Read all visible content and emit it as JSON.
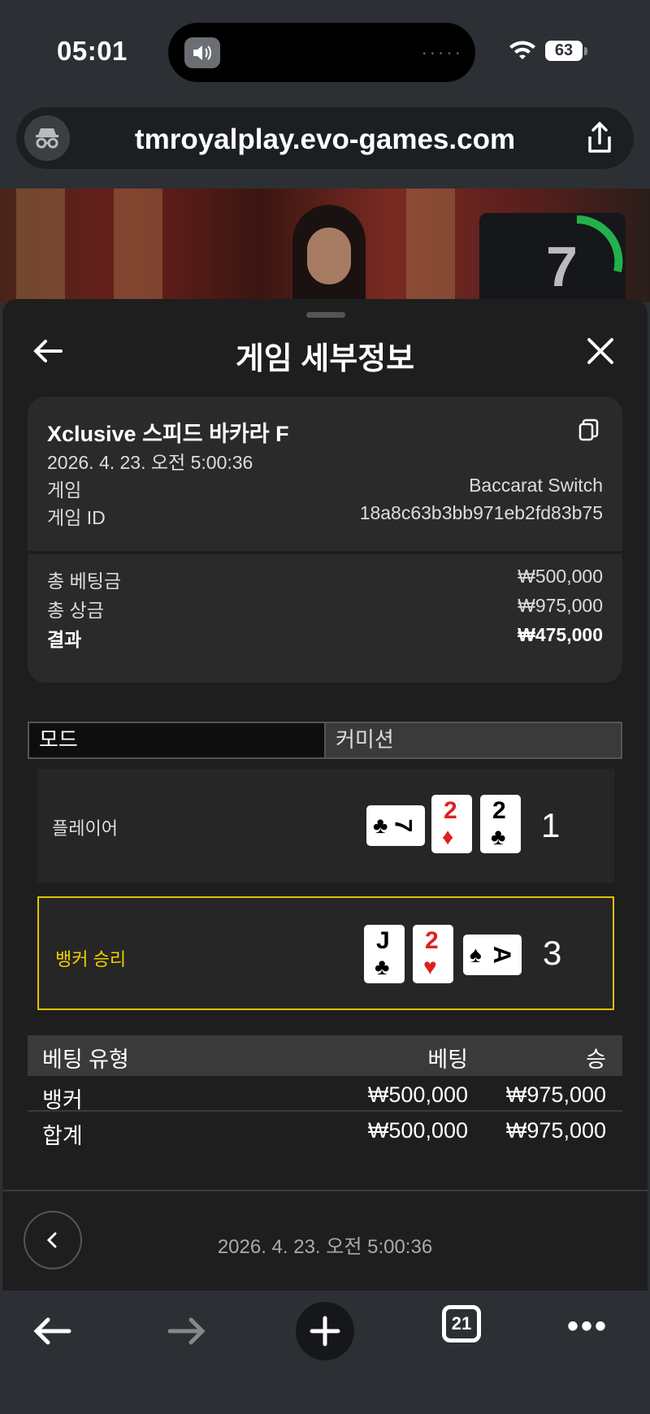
{
  "status": {
    "time": "05:01",
    "battery": "63"
  },
  "browser": {
    "url": "tmroyalplay.evo-games.com",
    "tab_count": "21"
  },
  "video": {
    "timer": "7"
  },
  "sheet": {
    "title": "게임 세부정보",
    "game": {
      "name": "Xclusive 스피드 바카라 F",
      "date": "2026. 4. 23. 오전 5:00:36",
      "game_label": "게임",
      "game_value": "Baccarat Switch",
      "id_label": "게임 ID",
      "id_value": "18a8c63b3bb971eb2fd83b75"
    },
    "totals": {
      "bet_label": "총 베팅금",
      "bet_value": "₩500,000",
      "win_label": "총 상금",
      "win_value": "₩975,000",
      "result_label": "결과",
      "result_value": "₩475,000"
    },
    "tabs": {
      "mode": "모드",
      "commission": "커미션"
    },
    "player": {
      "label": "플레이어",
      "score": "1",
      "cards": [
        {
          "rank": "7",
          "suit": "♣",
          "color": "#000000",
          "orientation": "sideways"
        },
        {
          "rank": "2",
          "suit": "♦",
          "color": "#e0201f",
          "orientation": "upright"
        },
        {
          "rank": "2",
          "suit": "♣",
          "color": "#000000",
          "orientation": "upright"
        }
      ]
    },
    "banker": {
      "label": "뱅커 승리",
      "score": "3",
      "cards": [
        {
          "rank": "J",
          "suit": "♣",
          "color": "#000000",
          "orientation": "upright"
        },
        {
          "rank": "2",
          "suit": "♥",
          "color": "#e0201f",
          "orientation": "upright"
        },
        {
          "rank": "A",
          "suit": "♠",
          "color": "#000000",
          "orientation": "sideways"
        }
      ]
    },
    "bets": {
      "headers": {
        "type": "베팅 유형",
        "bet": "베팅",
        "win": "승"
      },
      "rows": [
        {
          "type": "뱅커",
          "bet": "₩500,000",
          "win": "₩975,000"
        },
        {
          "type": "합계",
          "bet": "₩500,000",
          "win": "₩975,000"
        }
      ]
    },
    "footer_date": "2026. 4. 23. 오전 5:00:36"
  },
  "colors": {
    "highlight": "#e0c200",
    "red_suit": "#e0201f",
    "timer_ring": "#22b14c"
  },
  "icons": [
    "speaker-icon",
    "wifi-icon",
    "battery-icon",
    "incognito-icon",
    "share-icon",
    "back-arrow-icon",
    "close-icon",
    "copy-icon",
    "chevron-left-icon",
    "plus-icon",
    "tabs-icon",
    "more-icon"
  ]
}
